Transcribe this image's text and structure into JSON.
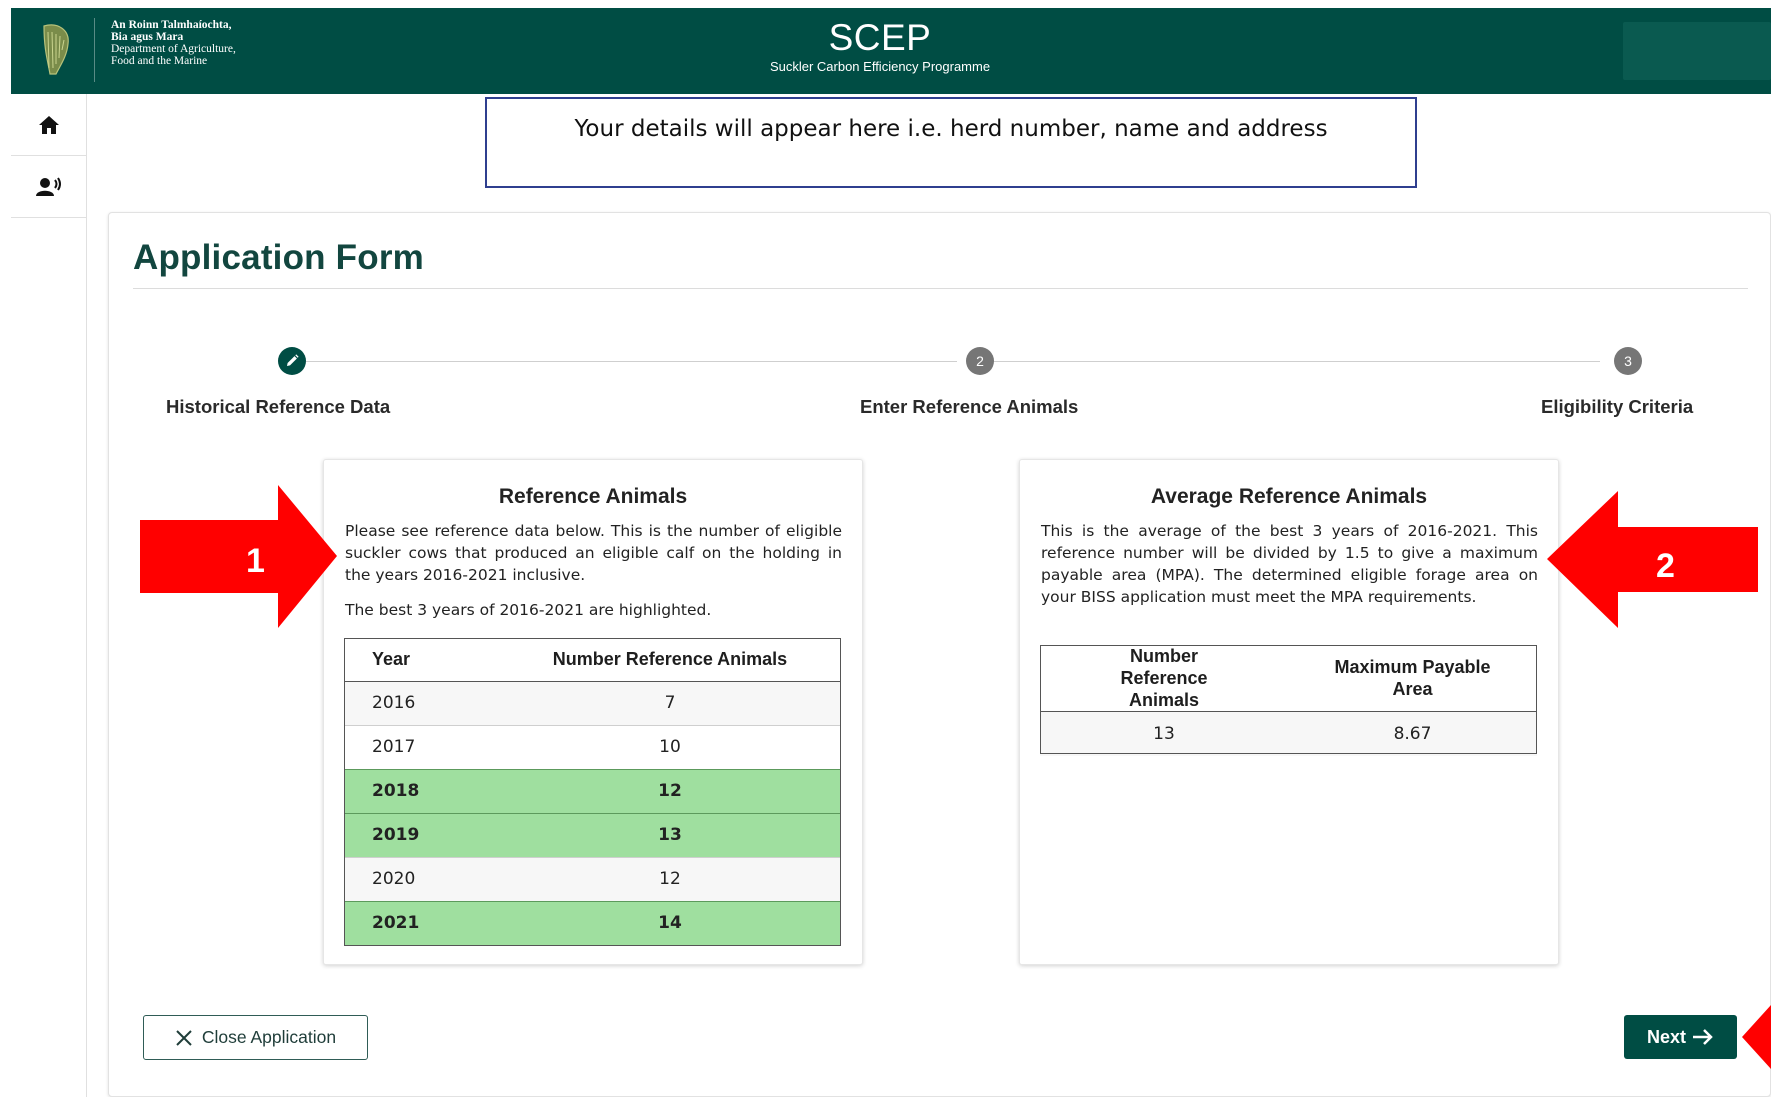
{
  "header": {
    "dept_lines": [
      "An Roinn Talmhaíochta,",
      "Bia agus Mara",
      "Department of Agriculture,",
      "Food and the Marine"
    ],
    "app_title": "SCEP",
    "app_subtitle": "Suckler Carbon Efficiency Programme",
    "logo_icon": "harp-icon"
  },
  "rail": {
    "items": [
      {
        "icon": "home-icon"
      },
      {
        "icon": "speaking-person-icon"
      }
    ]
  },
  "details_notice": "Your details will appear here i.e. herd number, name and address",
  "form": {
    "title": "Application Form",
    "steps": [
      {
        "marker": "edit-icon",
        "label": "Historical Reference Data",
        "state": "active"
      },
      {
        "marker": "2",
        "label": "Enter Reference Animals",
        "state": "pending"
      },
      {
        "marker": "3",
        "label": "Eligibility Criteria",
        "state": "pending"
      }
    ]
  },
  "reference_panel": {
    "title": "Reference Animals",
    "description": "Please see reference data below. This is the number of eligible suckler cows that produced an eligible calf on the holding in the years 2016-2021 inclusive.",
    "note": "The best 3 years of 2016-2021 are highlighted.",
    "columns": [
      "Year",
      "Number Reference Animals"
    ],
    "rows": [
      {
        "year": "2016",
        "value": "7",
        "highlighted": false
      },
      {
        "year": "2017",
        "value": "10",
        "highlighted": false
      },
      {
        "year": "2018",
        "value": "12",
        "highlighted": true
      },
      {
        "year": "2019",
        "value": "13",
        "highlighted": true
      },
      {
        "year": "2020",
        "value": "12",
        "highlighted": false
      },
      {
        "year": "2021",
        "value": "14",
        "highlighted": true
      }
    ]
  },
  "average_panel": {
    "title": "Average Reference Animals",
    "description": "This is the average of the best 3 years of 2016-2021. This reference number will be divided by 1.5 to give a maximum payable area (MPA). The determined eligible forage area on your BISS application must meet the MPA requirements.",
    "columns": [
      "Number Reference Animals",
      "Maximum Payable Area"
    ],
    "row": {
      "animals": "13",
      "mpa": "8.67"
    }
  },
  "annotations": {
    "arrow_1": "1",
    "arrow_2": "2",
    "color": "#ff0000"
  },
  "buttons": {
    "close_label": "Close Application",
    "next_label": "Next"
  },
  "colors": {
    "brand": "#004d44",
    "highlight": "#9fdf9f",
    "title": "#12463f"
  }
}
